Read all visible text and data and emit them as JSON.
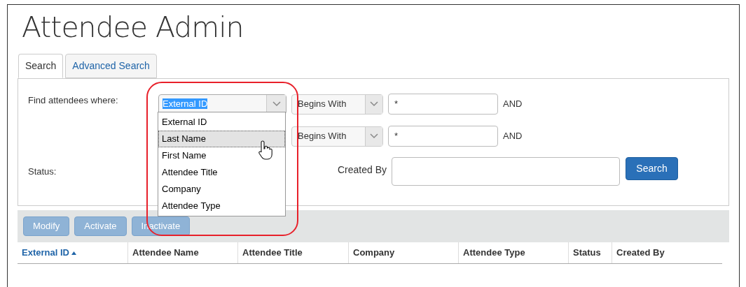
{
  "title": "Attendee Admin",
  "tabs": [
    {
      "label": "Search",
      "selected": true
    },
    {
      "label": "Advanced Search",
      "selected": false
    }
  ],
  "form": {
    "find_label": "Find attendees where:",
    "criteria": [
      {
        "field": "External ID",
        "operator": "Begins With",
        "value": "*",
        "joiner": "AND",
        "expanded": true
      },
      {
        "operator": "Begins With",
        "value": "*",
        "joiner": "AND"
      }
    ],
    "field_options": [
      {
        "label": "External ID",
        "selected": false
      },
      {
        "label": "Last Name",
        "selected": true
      },
      {
        "label": "First Name",
        "selected": false
      },
      {
        "label": "Attendee Title",
        "selected": false
      },
      {
        "label": "Company",
        "selected": false
      },
      {
        "label": "Attendee Type",
        "selected": false
      }
    ],
    "status_label": "Status:",
    "created_by_label": "Created By",
    "search_button": "Search"
  },
  "actions": [
    {
      "label": "Modify",
      "disabled": true
    },
    {
      "label": "Activate",
      "disabled": true
    },
    {
      "label": "Inactivate",
      "disabled": true
    }
  ],
  "table": {
    "columns": [
      {
        "label": "External ID",
        "sorted": true
      },
      {
        "label": "Attendee Name",
        "sorted": false
      },
      {
        "label": "Attendee Title",
        "sorted": false
      },
      {
        "label": "Company",
        "sorted": false
      },
      {
        "label": "Attendee Type",
        "sorted": false
      },
      {
        "label": "Status",
        "sorted": false
      },
      {
        "label": "Created By",
        "sorted": false
      }
    ]
  }
}
